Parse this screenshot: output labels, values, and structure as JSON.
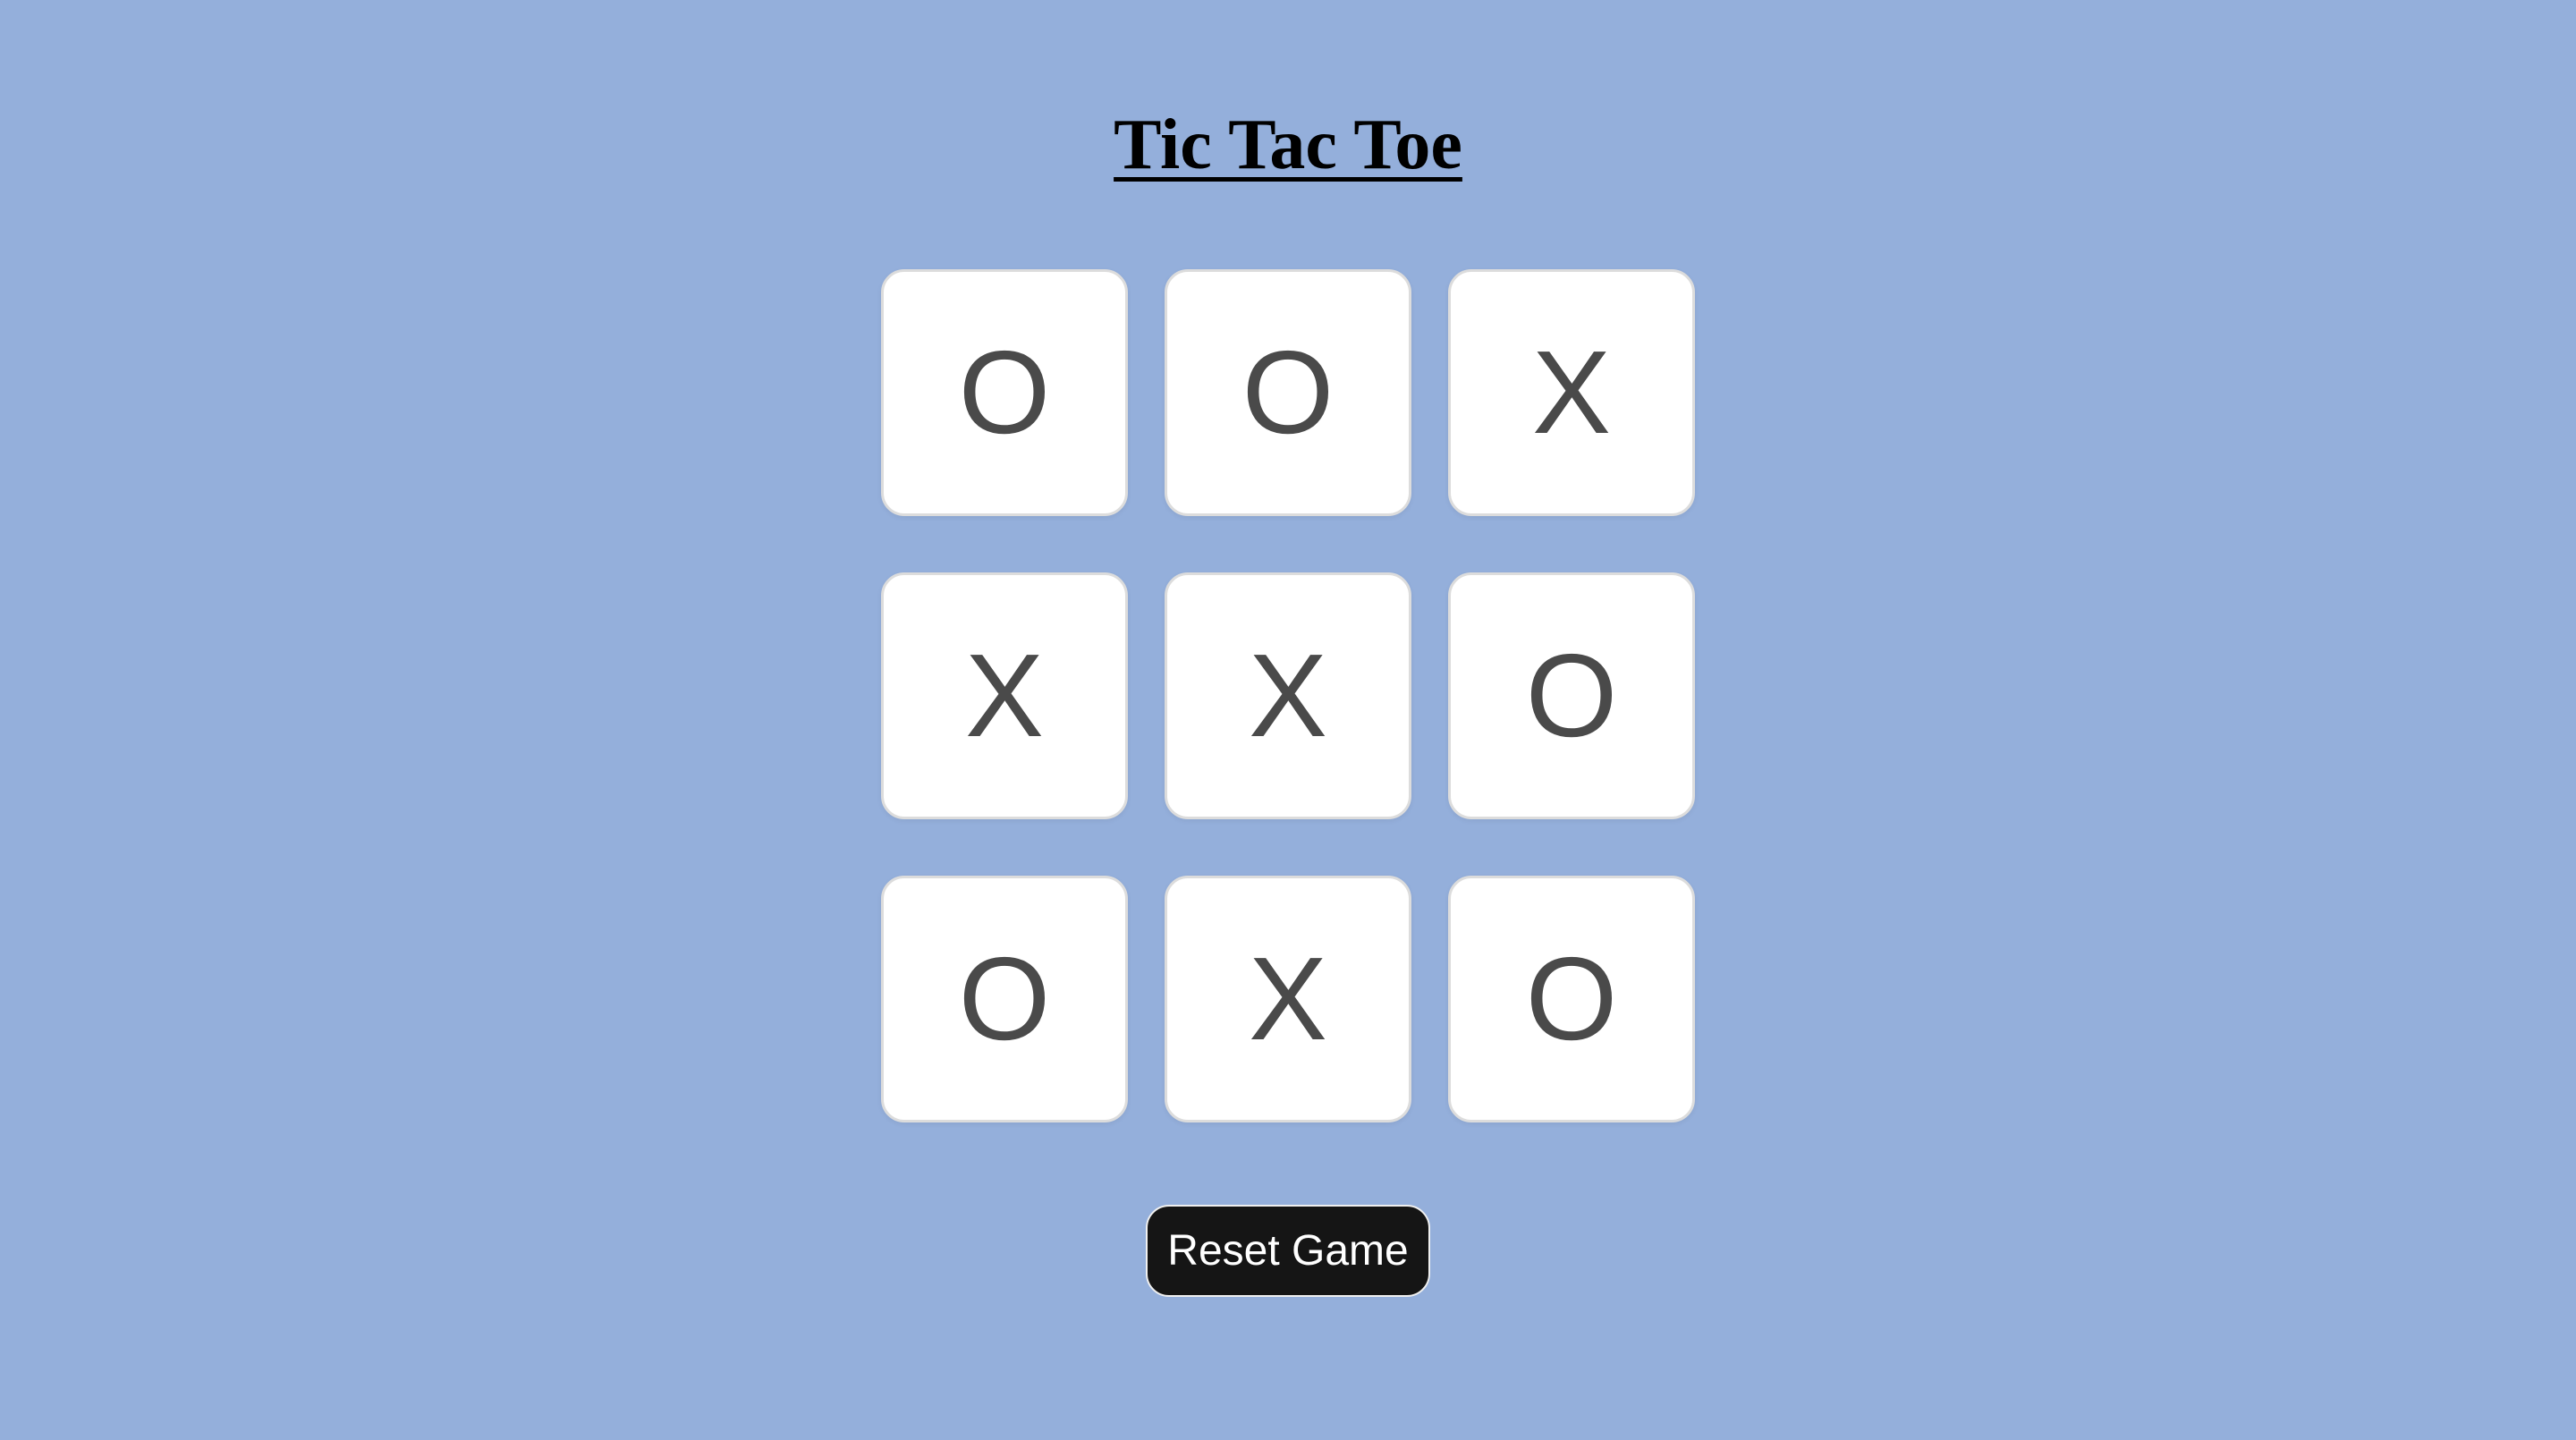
{
  "title": "Tic Tac Toe",
  "board": {
    "cells": [
      "O",
      "O",
      "X",
      "X",
      "X",
      "O",
      "O",
      "X",
      "O"
    ]
  },
  "reset_button": {
    "label": "Reset Game"
  },
  "colors": {
    "background": "#94afdb",
    "cell_background": "#ffffff",
    "mark_color": "#4a4a4a",
    "button_background": "#151515",
    "button_text": "#ffffff"
  }
}
